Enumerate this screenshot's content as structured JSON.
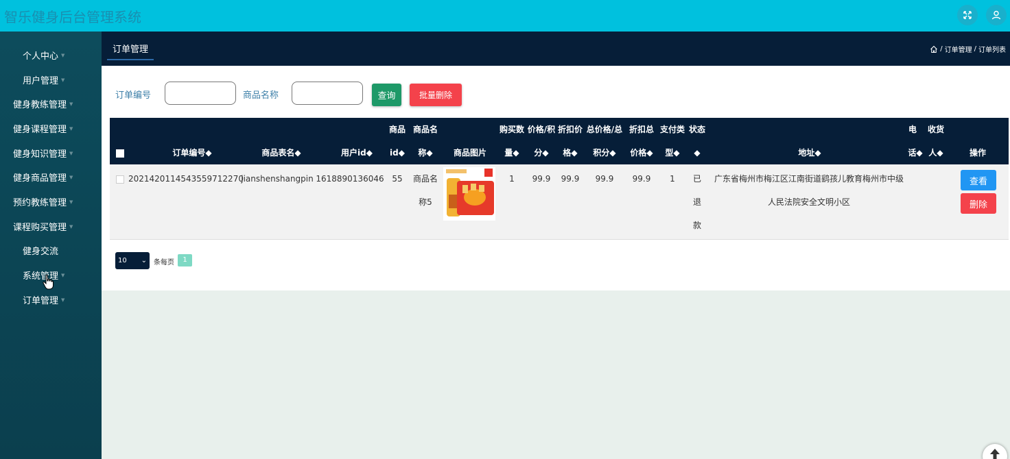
{
  "app": {
    "title": "智乐健身后台管理系统"
  },
  "sidebar": {
    "items": [
      {
        "label": "个人中心"
      },
      {
        "label": "用户管理"
      },
      {
        "label": "健身教练管理"
      },
      {
        "label": "健身课程管理"
      },
      {
        "label": "健身知识管理"
      },
      {
        "label": "健身商品管理"
      },
      {
        "label": "预约教练管理"
      },
      {
        "label": "课程购买管理"
      },
      {
        "label": "健身交流"
      },
      {
        "label": "系统管理"
      },
      {
        "label": "订单管理"
      }
    ]
  },
  "header": {
    "tab": "订单管理",
    "breadcrumb": [
      "订单管理",
      "订单列表"
    ]
  },
  "search": {
    "order_no_label": "订单编号",
    "product_name_label": "商品名称",
    "order_no_value": "",
    "product_name_value": "",
    "query_button": "查询",
    "batch_delete_button": "批量删除"
  },
  "table": {
    "headers": [
      {
        "l1": "",
        "l2": "订单编号◆"
      },
      {
        "l1": "",
        "l2": "商品表名◆"
      },
      {
        "l1": "",
        "l2": "用户id◆"
      },
      {
        "l1": "商品",
        "l2": "id◆"
      },
      {
        "l1": "商品名",
        "l2": "称◆"
      },
      {
        "l1": "",
        "l2": "商品图片"
      },
      {
        "l1": "购买数",
        "l2": "量◆"
      },
      {
        "l1": "价格/积",
        "l2": "分◆"
      },
      {
        "l1": "折扣价",
        "l2": "格◆"
      },
      {
        "l1": "总价格/总",
        "l2": "积分◆"
      },
      {
        "l1": "折扣总",
        "l2": "价格◆"
      },
      {
        "l1": "支付类",
        "l2": "型◆"
      },
      {
        "l1": "状态",
        "l2": "◆"
      },
      {
        "l1": "",
        "l2": "地址◆"
      },
      {
        "l1": "电",
        "l2": "话◆"
      },
      {
        "l1": "收货",
        "l2": "人◆"
      },
      {
        "l1": "",
        "l2": "操作"
      }
    ],
    "rows": [
      {
        "order_no": "2021420114543559712270",
        "table_name": "jianshenshangpin",
        "user_id": "1618890136046",
        "product_id": "55",
        "product_name_l1": "商品名",
        "product_name_l2": "称5",
        "quantity": "1",
        "price": "99.9",
        "discount_price": "99.9",
        "total": "99.9",
        "discount_total": "99.9",
        "pay_type": "1",
        "status_l1": "已",
        "status_l2": "退",
        "status_l3": "款",
        "address_l1": "广东省梅州市梅江区江南街道鹞孩儿教育梅州市中级",
        "address_l2": "人民法院安全文明小区",
        "phone": "",
        "receiver": "",
        "view_button": "查看",
        "delete_button": "删除"
      }
    ]
  },
  "pagination": {
    "page_size": "10",
    "per_page_label": "条每页",
    "current_page": "1"
  },
  "colors": {
    "topbar": "#00c1de",
    "sidebar": "#0d4c5c",
    "header": "#061e38",
    "query_button": "#1e9968",
    "delete_button": "#f4424b",
    "view_button": "#2196f3"
  }
}
